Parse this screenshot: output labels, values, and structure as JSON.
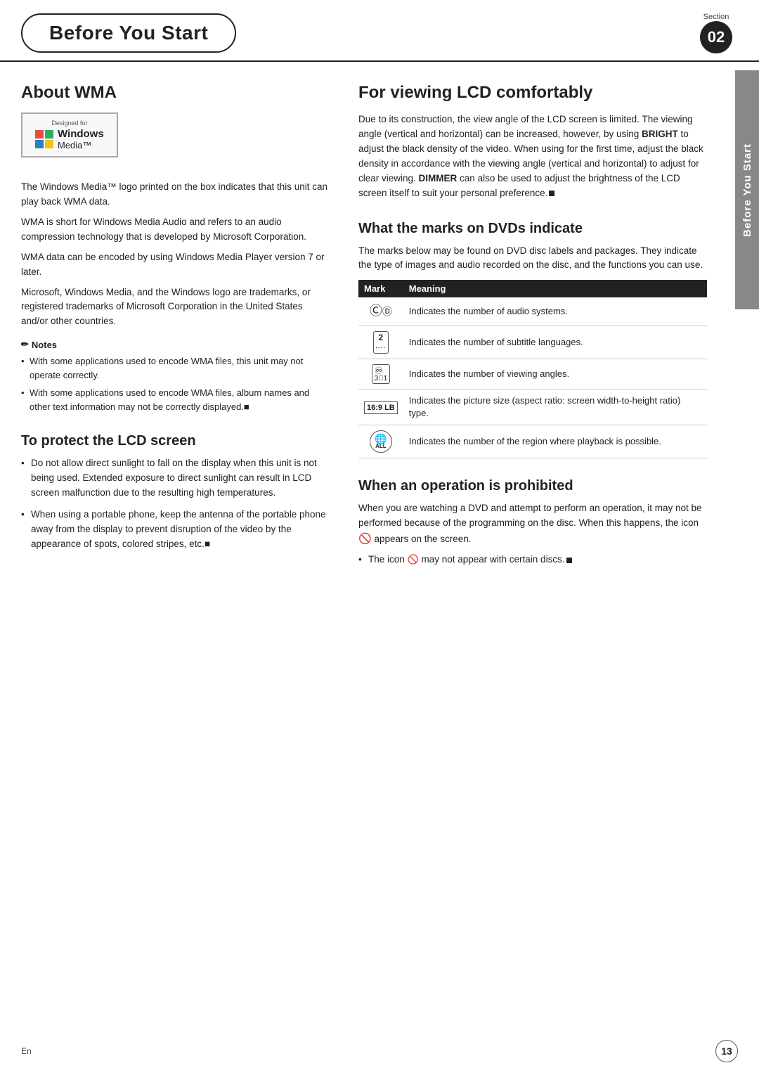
{
  "header": {
    "title": "Before You Start",
    "section_label": "Section",
    "section_number": "02"
  },
  "side_tab": {
    "text": "Before You Start"
  },
  "left": {
    "about_wma": {
      "heading": "About WMA",
      "logo": {
        "designed_for": "Designed for",
        "windows": "Windows",
        "media": "Media™"
      },
      "paragraphs": [
        "The Windows Media™ logo printed on the box indicates that this unit can play back WMA data.",
        "WMA is short for Windows Media Audio and refers to an audio compression technology that is developed by Microsoft Corporation.",
        "WMA data can be encoded by using Windows Media Player version 7 or later.",
        "Microsoft, Windows Media, and the Windows logo are trademarks, or registered trademarks of Microsoft Corporation in the United States and/or other countries."
      ],
      "notes_title": "Notes",
      "notes": [
        "With some applications used to encode WMA files, this unit may not operate correctly.",
        "With some applications used to encode WMA files, album names and other text information may not be correctly displayed.■"
      ]
    },
    "lcd_screen": {
      "heading": "To protect the LCD screen",
      "bullets": [
        "Do not allow direct sunlight to fall on the display when this unit is not being used. Extended exposure to direct sunlight can result in LCD screen malfunction due to the resulting high temperatures.",
        "When using a portable phone, keep the antenna of the portable phone away from the display to prevent disruption of the video by the appearance of spots, colored stripes, etc.■"
      ]
    }
  },
  "right": {
    "lcd_comfort": {
      "heading": "For viewing LCD comfortably",
      "text": "Due to its construction, the view angle of the LCD screen is limited. The viewing angle (vertical and horizontal) can be increased, however, by using BRIGHT to adjust the black density of the video. When using for the first time, adjust the black density in accordance with the viewing angle (vertical and horizontal) to adjust for clear viewing. DIMMER can also be used to adjust the brightness of the LCD screen itself to suit your personal preference.■"
    },
    "dvd_marks": {
      "heading": "What the marks on DVDs indicate",
      "intro": "The marks below may be found on DVD disc labels and packages. They indicate the type of images and audio recorded on the disc, and the functions you can use.",
      "table_headers": [
        "Mark",
        "Meaning"
      ],
      "rows": [
        {
          "mark_symbol": "audio",
          "meaning": "Indicates the number of audio systems."
        },
        {
          "mark_symbol": "subtitle",
          "meaning": "Indicates the number of subtitle languages."
        },
        {
          "mark_symbol": "angles",
          "meaning": "Indicates the number of viewing angles."
        },
        {
          "mark_symbol": "aspect",
          "meaning": "Indicates the picture size (aspect ratio: screen width-to-height ratio) type."
        },
        {
          "mark_symbol": "region",
          "meaning": "Indicates the number of the region where playback is possible."
        }
      ]
    },
    "prohibited": {
      "heading": "When an operation is prohibited",
      "paragraphs": [
        "When you are watching a DVD and attempt to perform an operation, it may not be performed because of the programming on the disc. When this happens, the icon 🚫 appears on the screen."
      ],
      "bullets": [
        "The icon 🚫 may not appear with certain discs.■"
      ]
    }
  },
  "footer": {
    "lang": "En",
    "page": "13"
  }
}
